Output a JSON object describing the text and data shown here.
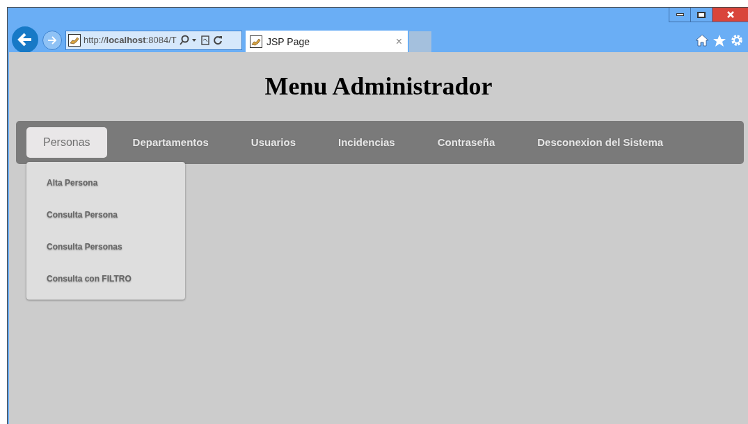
{
  "browser": {
    "address": "http://**localhost**:8084/T",
    "tab_title": "JSP Page",
    "tab_close": "×"
  },
  "page": {
    "heading": "Menu Administrador"
  },
  "nav": {
    "items": [
      {
        "label": "Personas",
        "selected": true,
        "expanded": true,
        "submenu": [
          "Alta Persona",
          "Consulta Persona",
          "Consulta Personas",
          "Consulta con FILTRO"
        ]
      },
      {
        "label": "Departamentos",
        "selected": false
      },
      {
        "label": "Usuarios",
        "selected": false
      },
      {
        "label": "Incidencias",
        "selected": false
      },
      {
        "label": "Contraseña",
        "selected": false
      },
      {
        "label": "Desconexion del Sistema",
        "selected": false
      }
    ]
  }
}
